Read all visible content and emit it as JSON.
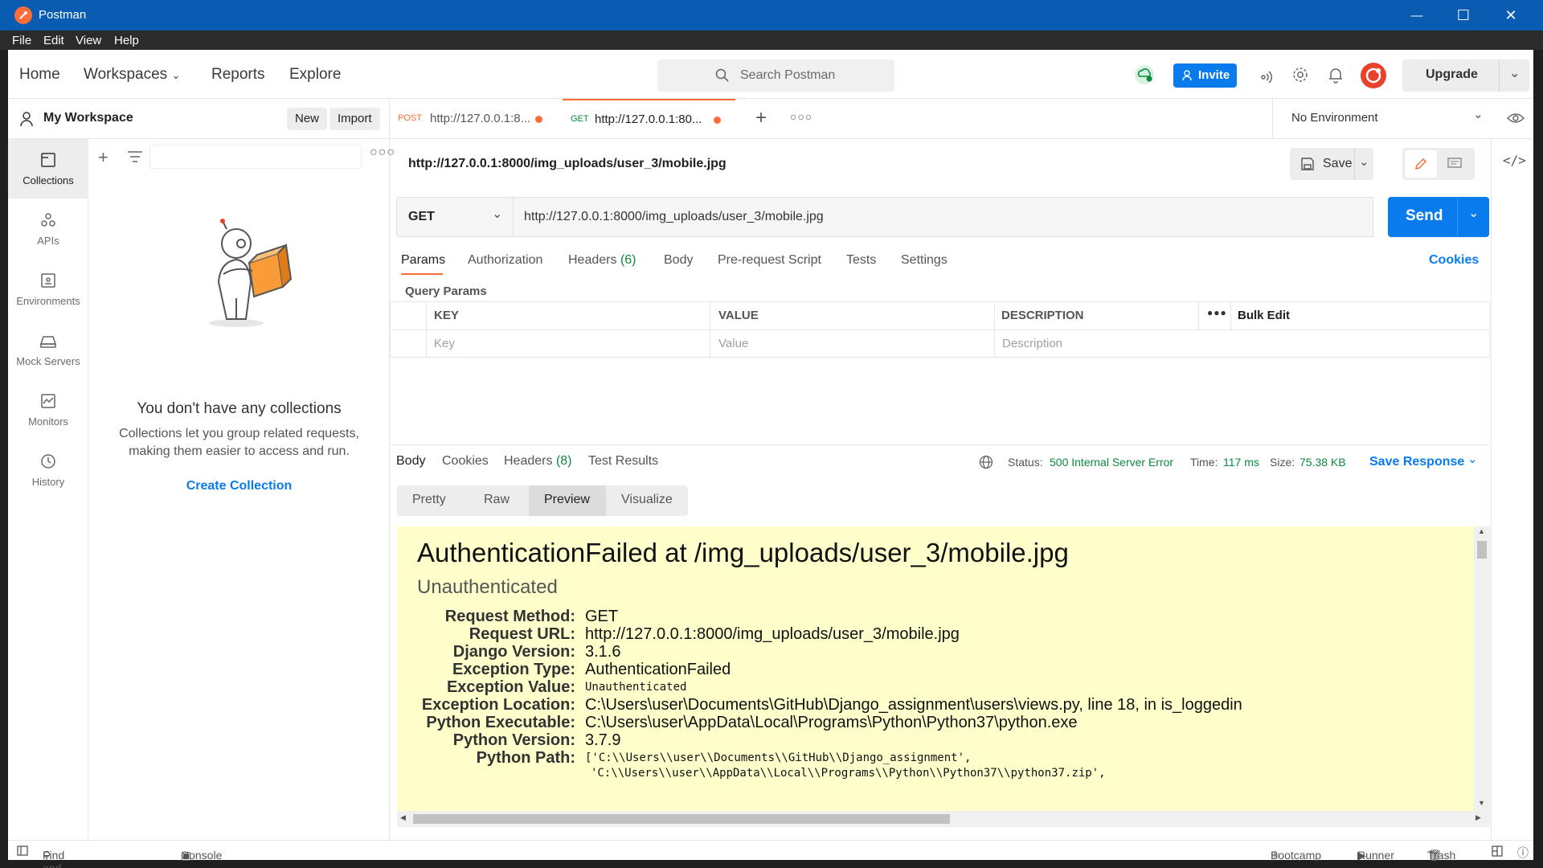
{
  "window": {
    "title": "Postman",
    "minimize_glyph": "—",
    "maximize_glyph": "☐",
    "close_glyph": "✕"
  },
  "menubar": [
    "File",
    "Edit",
    "View",
    "Help"
  ],
  "header": {
    "nav": [
      "Home",
      "Workspaces",
      "Reports",
      "Explore"
    ],
    "search_placeholder": "Search Postman",
    "invite_label": "Invite",
    "upgrade_label": "Upgrade"
  },
  "workspace": {
    "name": "My Workspace",
    "new_label": "New",
    "import_label": "Import"
  },
  "rail": [
    {
      "label": "Collections",
      "icon": "collections-icon"
    },
    {
      "label": "APIs",
      "icon": "apis-icon"
    },
    {
      "label": "Environments",
      "icon": "environments-icon"
    },
    {
      "label": "Mock Servers",
      "icon": "mock-servers-icon"
    },
    {
      "label": "Monitors",
      "icon": "monitors-icon"
    },
    {
      "label": "History",
      "icon": "history-icon"
    }
  ],
  "collections": {
    "empty_title": "You don't have any collections",
    "empty_line1": "Collections let you group related requests,",
    "empty_line2": "making them easier to access and run.",
    "create_link": "Create Collection"
  },
  "tabs": [
    {
      "method": "POST",
      "url": "http://127.0.0.1:8...",
      "method_color": "#ff6c37"
    },
    {
      "method": "GET",
      "url": "http://127.0.0.1:80...",
      "method_color": "#0a8a3c"
    }
  ],
  "environment": {
    "selected": "No Environment"
  },
  "request": {
    "title": "http://127.0.0.1:8000/img_uploads/user_3/mobile.jpg",
    "save_label": "Save",
    "method": "GET",
    "url": "http://127.0.0.1:8000/img_uploads/user_3/mobile.jpg",
    "send_label": "Send",
    "subtabs": [
      "Params",
      "Authorization",
      "Headers",
      "Body",
      "Pre-request Script",
      "Tests",
      "Settings"
    ],
    "headers_count": "(6)",
    "cookies_link": "Cookies",
    "query_params_title": "Query Params",
    "params_columns": [
      "KEY",
      "VALUE",
      "DESCRIPTION"
    ],
    "bulk_edit_label": "Bulk Edit",
    "params_placeholders": [
      "Key",
      "Value",
      "Description"
    ]
  },
  "response": {
    "tabs": [
      "Body",
      "Cookies",
      "Headers",
      "Test Results"
    ],
    "headers_count": "(8)",
    "status_label": "Status:",
    "status_value": "500 Internal Server Error",
    "time_label": "Time:",
    "time_value": "117 ms",
    "size_label": "Size:",
    "size_value": "75.38 KB",
    "save_response_label": "Save Response",
    "view_modes": [
      "Pretty",
      "Raw",
      "Preview",
      "Visualize"
    ],
    "active_view": "Preview"
  },
  "preview": {
    "heading": "AuthenticationFailed at /img_uploads/user_3/mobile.jpg",
    "subheading": "Unauthenticated",
    "meta": [
      {
        "key": "Request Method:",
        "value": "GET"
      },
      {
        "key": "Request URL:",
        "value": "http://127.0.0.1:8000/img_uploads/user_3/mobile.jpg"
      },
      {
        "key": "Django Version:",
        "value": "3.1.6"
      },
      {
        "key": "Exception Type:",
        "value": "AuthenticationFailed"
      },
      {
        "key": "Exception Value:",
        "value": "Unauthenticated"
      },
      {
        "key": "Exception Location:",
        "value": "C:\\Users\\user\\Documents\\GitHub\\Django_assignment\\users\\views.py, line 18, in is_loggedin"
      },
      {
        "key": "Python Executable:",
        "value": "C:\\Users\\user\\AppData\\Local\\Programs\\Python\\Python37\\python.exe"
      },
      {
        "key": "Python Version:",
        "value": "3.7.9"
      },
      {
        "key": "Python Path:",
        "value": "['C:\\\\Users\\\\user\\\\Documents\\\\GitHub\\\\Django_assignment',"
      }
    ],
    "path_line2": "'C:\\\\Users\\\\user\\\\AppData\\\\Local\\\\Programs\\\\Python\\\\Python37\\\\python37.zip',"
  },
  "footer": {
    "left": [
      "Find and Replace",
      "Console"
    ],
    "right": [
      "Bootcamp",
      "Runner",
      "Trash"
    ]
  },
  "colors": {
    "brand": "#ff6c37",
    "primary": "#097bed",
    "status_ok": "#0a8a3c",
    "preview_bg": "#ffffcc",
    "titlebar": "#0a5bb2"
  }
}
